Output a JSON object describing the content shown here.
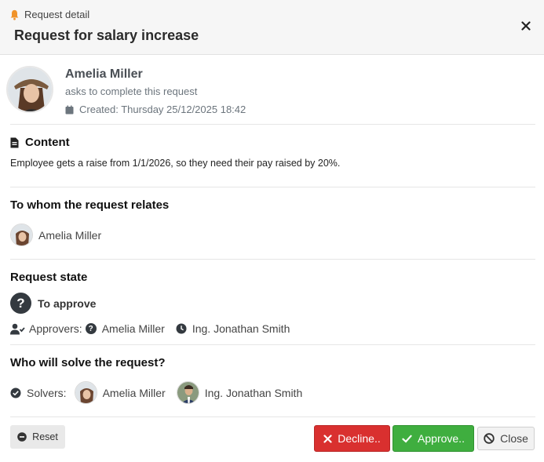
{
  "header": {
    "kicker": "Request detail",
    "title": "Request for salary increase"
  },
  "requester": {
    "name": "Amelia Miller",
    "subtitle": "asks to complete this request",
    "created": "Created: Thursday 25/12/2025 18:42"
  },
  "content": {
    "heading": "Content",
    "text": "Employee gets a raise from 1/1/2026, so they need their pay raised by 20%."
  },
  "relates": {
    "heading": "To whom the request relates",
    "person": "Amelia Miller"
  },
  "state": {
    "heading": "Request state",
    "value": "To approve",
    "approvers_label": "Approvers:",
    "approvers": [
      "Amelia Miller",
      "Ing. Jonathan Smith"
    ]
  },
  "solvers": {
    "heading": "Who will solve the request?",
    "label": "Solvers:",
    "people": [
      "Amelia Miller",
      "Ing. Jonathan Smith"
    ]
  },
  "buttons": {
    "reset": "Reset",
    "decline": "Decline..",
    "approve": "Approve..",
    "close": "Close"
  },
  "colors": {
    "decline": "#d9302f",
    "approve": "#3fae3f",
    "bell": "#f0932b"
  },
  "icons": [
    "bell-icon",
    "close-icon",
    "calendar-icon",
    "file-icon",
    "question-icon",
    "user-check-icon",
    "clock-icon",
    "check-circle-icon",
    "minus-circle-icon",
    "x-icon",
    "check-icon",
    "ban-icon"
  ]
}
